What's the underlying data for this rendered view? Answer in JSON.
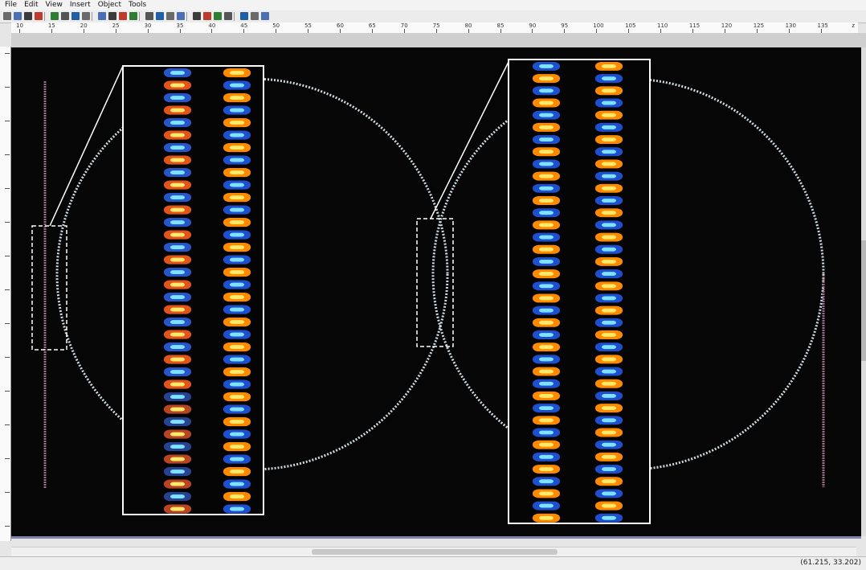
{
  "menubar": {
    "items": [
      "File",
      "Edit",
      "View",
      "Insert",
      "Object",
      "Tools"
    ]
  },
  "ruler": {
    "h_ticks": [
      "10",
      "15",
      "20",
      "25",
      "30",
      "35",
      "40",
      "45",
      "50",
      "55",
      "60",
      "65",
      "70",
      "75",
      "80",
      "85",
      "90",
      "95",
      "100",
      "105",
      "110",
      "115",
      "120",
      "125",
      "130",
      "135"
    ],
    "h_unit": "z"
  },
  "statusbar": {
    "coordinates": "(61.215, 33.202)"
  },
  "colors": {
    "background": "#060606",
    "field_warm": "#ff8a00",
    "field_hot": "#ffe96b",
    "field_cool": "#1d4fcf",
    "field_cyan": "#7de2ff",
    "frame": "#ffffff"
  },
  "toolbar_icons": [
    "cut-icon",
    "copy-icon",
    "paste-icon",
    "undo-icon",
    "redo-icon",
    "select-icon",
    "pan-icon",
    "zoom-icon",
    "zoom-fit-icon",
    "grid-icon",
    "snap-icon",
    "layer-icon",
    "waveguide-icon",
    "ring-icon",
    "taper-icon",
    "coupler-icon",
    "arrow-icon",
    "port-icon",
    "monitor-icon",
    "run-icon",
    "view-icon",
    "chart-icon",
    "export-icon"
  ]
}
